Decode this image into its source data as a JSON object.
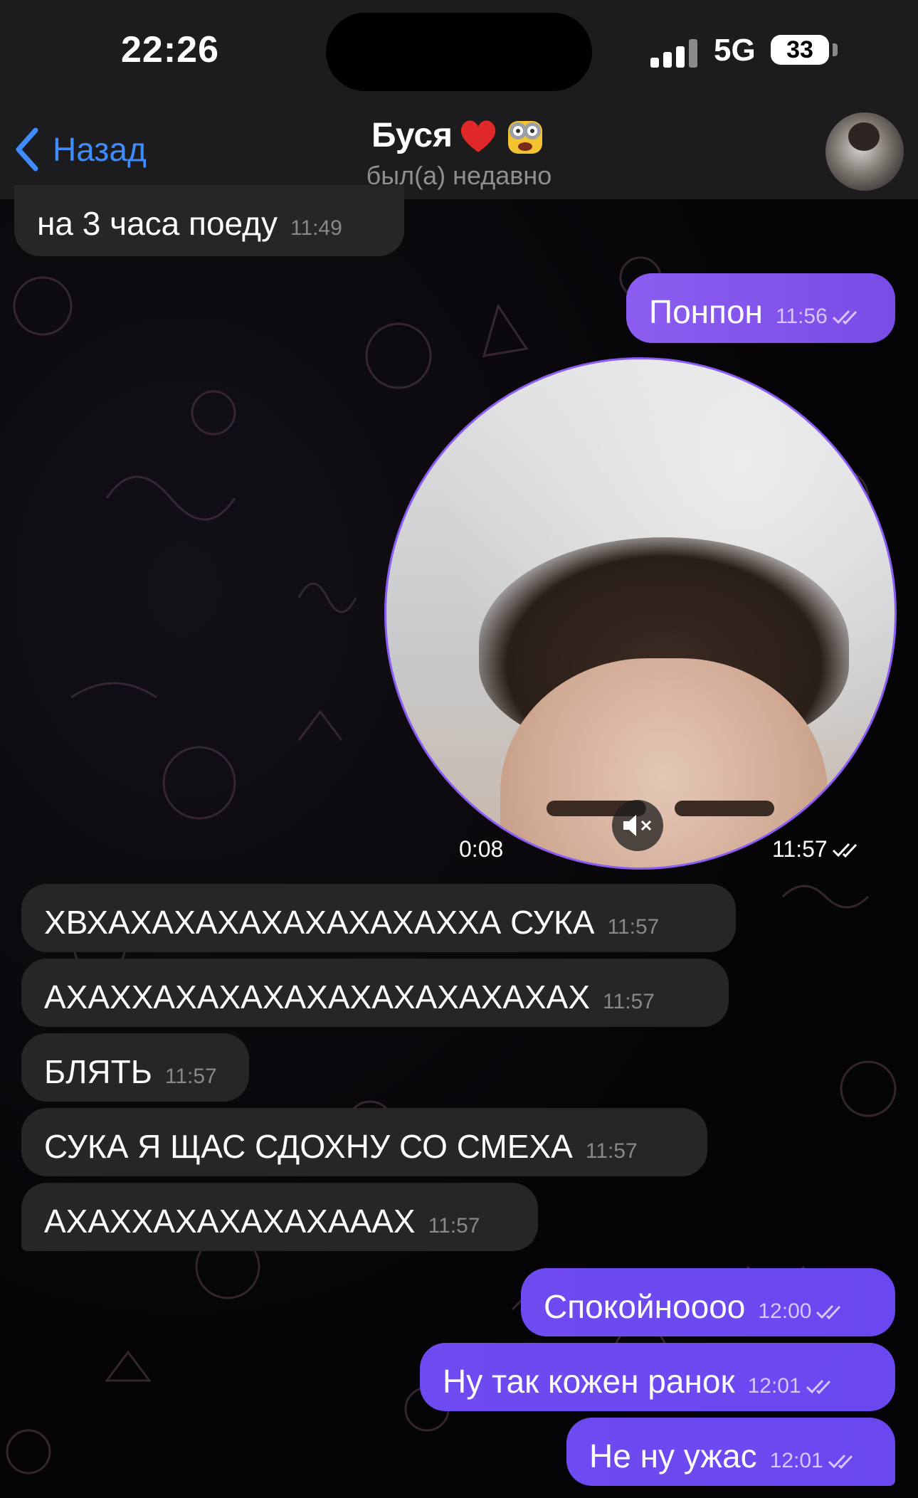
{
  "status_bar": {
    "time": "22:26",
    "network": "5G",
    "battery": "33"
  },
  "header": {
    "back_label": "Назад",
    "contact_name": "Буся",
    "contact_status": "был(а) недавно"
  },
  "messages": [
    {
      "side": "in",
      "text": "на 3 часа поеду",
      "time": "11:49"
    },
    {
      "side": "out",
      "text": "Понпон",
      "time": "11:56"
    },
    {
      "side": "out",
      "type": "video",
      "duration": "0:08",
      "time": "11:57"
    },
    {
      "side": "in",
      "text": "ХВХАХАХАХАХАХАХАХАХХА СУКА",
      "time": "11:57"
    },
    {
      "side": "in",
      "text": "АХАХХАХАХАХАХАХАХАХАХАХАХ",
      "time": "11:57"
    },
    {
      "side": "in",
      "text": "БЛЯТЬ",
      "time": "11:57"
    },
    {
      "side": "in",
      "text": "СУКА Я ЩАС СДОХНУ СО СМЕХА",
      "time": "11:57"
    },
    {
      "side": "in",
      "text": "АХАХХАХАХАХАХАААХ",
      "time": "11:57"
    },
    {
      "side": "out",
      "text": "Спокойноооо",
      "time": "12:00"
    },
    {
      "side": "out",
      "text": "Ну так кожен ранок",
      "time": "12:01"
    },
    {
      "side": "out",
      "text": "Не ну ужас",
      "time": "12:01"
    }
  ],
  "colors": {
    "accent": "#3e8cff",
    "outgoing": "#8c5df0",
    "incoming": "#272527"
  }
}
